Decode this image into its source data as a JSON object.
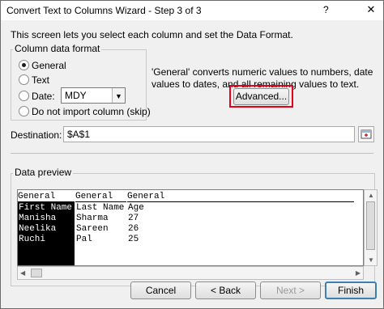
{
  "window": {
    "title": "Convert Text to Columns Wizard - Step 3 of 3",
    "help": "?",
    "close": "✕"
  },
  "intro": "This screen lets you select each column and set the Data Format.",
  "format": {
    "legend": "Column data format",
    "options": [
      {
        "label": "General",
        "checked": true
      },
      {
        "label": "Text",
        "checked": false
      },
      {
        "label": "Date:",
        "checked": false
      },
      {
        "label": "Do not import column (skip)",
        "checked": false
      }
    ],
    "date_value": "MDY"
  },
  "info_text": "'General' converts numeric values to numbers, date values to dates, and all remaining values to text.",
  "advanced_label": "Advanced...",
  "destination": {
    "label": "Destination:",
    "value": "$A$1"
  },
  "preview": {
    "legend": "Data preview",
    "headers": [
      "General",
      "General",
      "General"
    ],
    "rows": [
      [
        "First Name",
        "Last Name",
        "Age"
      ],
      [
        "Manisha",
        "Sharma",
        "27"
      ],
      [
        "Neelika",
        "Sareen",
        "26"
      ],
      [
        "Ruchi",
        "Pal",
        "25"
      ]
    ]
  },
  "buttons": {
    "cancel": "Cancel",
    "back": "< Back",
    "next": "Next >",
    "finish": "Finish"
  },
  "colors": {
    "highlight": "#e3001b",
    "selected_column": "#000000"
  }
}
